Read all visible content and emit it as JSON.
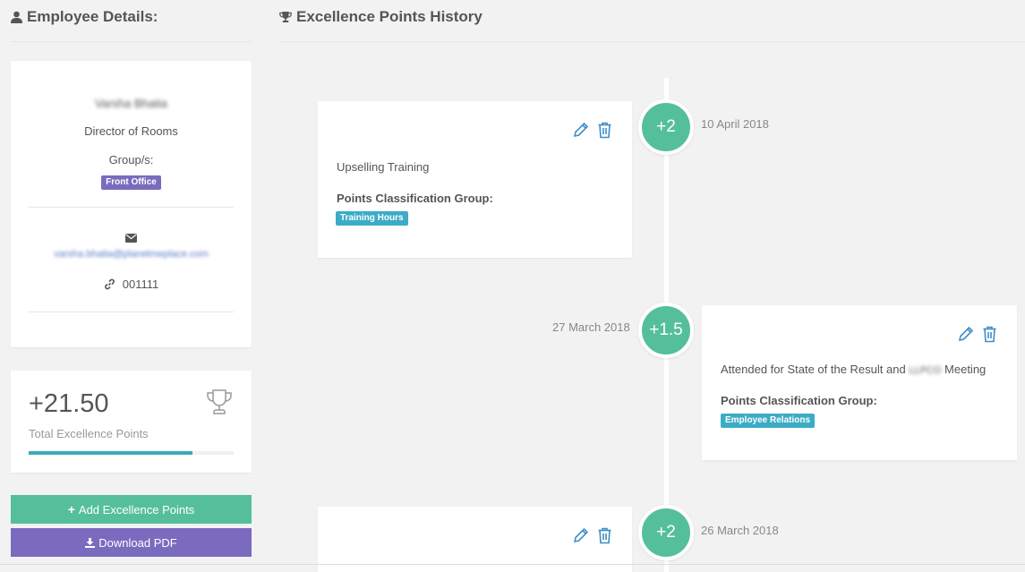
{
  "left": {
    "title": "Employee Details:",
    "profile": {
      "name": "Varsha Bhatia",
      "role": "Director of Rooms",
      "groups_label": "Group/s:",
      "group_badge": "Front Office",
      "email": "varsha.bhatia@planetmeplace.com",
      "employee_id": "001111"
    },
    "points": {
      "value": "+21.50",
      "label": "Total Excellence Points",
      "progress": 0.8
    },
    "buttons": {
      "add": "Add Excellence Points",
      "download": "Download PDF"
    }
  },
  "history": {
    "title": "Excellence Points History",
    "entries": [
      {
        "points": "+2",
        "date": "10 April 2018",
        "title": "Upselling Training",
        "group_label": "Points Classification Group:",
        "group_badge": "Training Hours"
      },
      {
        "points": "+1.5",
        "date": "27 March 2018",
        "title_pre": "Attended for State of the Result and",
        "title_blur": "LLPCO",
        "title_post": "Meeting",
        "group_label": "Points Classification Group:",
        "group_badge": "Employee Relations"
      },
      {
        "points": "+2",
        "date": "26 March 2018"
      }
    ]
  },
  "colors": {
    "green": "#55bf9b",
    "purple": "#7a6bbf",
    "teal": "#3cacc6",
    "icon_blue": "#3e8dc7"
  }
}
